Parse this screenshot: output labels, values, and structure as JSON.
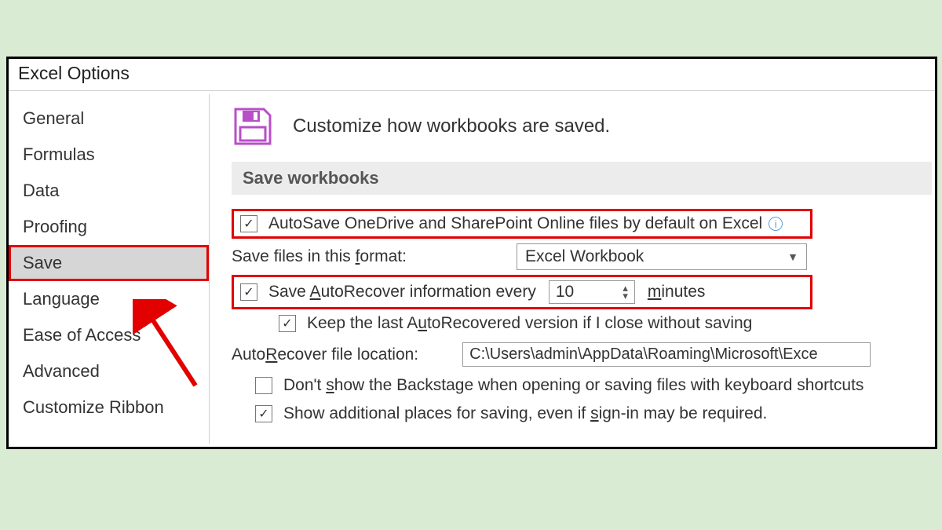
{
  "window": {
    "title": "Excel Options"
  },
  "sidebar": {
    "items": [
      {
        "label": "General"
      },
      {
        "label": "Formulas"
      },
      {
        "label": "Data"
      },
      {
        "label": "Proofing"
      },
      {
        "label": "Save"
      },
      {
        "label": "Language"
      },
      {
        "label": "Ease of Access"
      },
      {
        "label": "Advanced"
      },
      {
        "label": "Customize Ribbon"
      }
    ],
    "selected_index": 4
  },
  "content": {
    "header": "Customize how workbooks are saved.",
    "section_title": "Save workbooks",
    "autosave": {
      "checked": true,
      "label_pre": "AutoSave OneDrive and SharePoint Online files by default on Excel"
    },
    "format": {
      "label_pre": "Save files in this ",
      "hotkey": "f",
      "label_post": "ormat:",
      "value": "Excel Workbook"
    },
    "autorecover": {
      "checked": true,
      "label_pre": "Save ",
      "hotkey": "A",
      "label_mid": "utoRecover information every",
      "minutes": "10",
      "unit_hot": "m",
      "unit_post": "inutes"
    },
    "keep_last": {
      "checked": true,
      "label_pre": "Keep the last A",
      "hotkey": "u",
      "label_post": "toRecovered version if I close without saving"
    },
    "location": {
      "label_pre": "Auto",
      "hotkey": "R",
      "label_post": "ecover file location:",
      "value": "C:\\Users\\admin\\AppData\\Roaming\\Microsoft\\Exce"
    },
    "backstage": {
      "checked": false,
      "label_pre": "Don't ",
      "hotkey": "s",
      "label_post": "how the Backstage when opening or saving files with keyboard shortcuts"
    },
    "additional": {
      "checked": true,
      "label_pre": "Show additional places for saving, even if ",
      "hotkey": "s",
      "label_post": "ign-in may be required."
    }
  }
}
